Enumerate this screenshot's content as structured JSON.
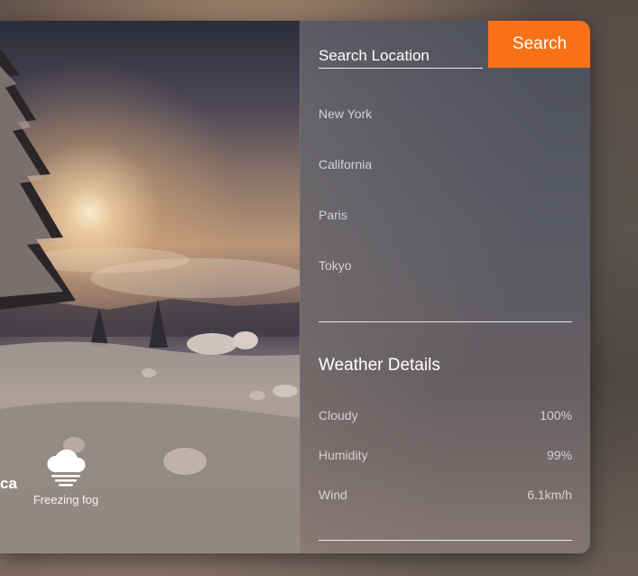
{
  "search": {
    "placeholder": "Search Location",
    "button_label": "Search"
  },
  "locations": [
    "New York",
    "California",
    "Paris",
    "Tokyo"
  ],
  "weather_details": {
    "title": "Weather Details",
    "rows": [
      {
        "label": "Cloudy",
        "value": "100%"
      },
      {
        "label": "Humidity",
        "value": "99%"
      },
      {
        "label": "Wind",
        "value": "6.1km/h"
      }
    ]
  },
  "current": {
    "city_fragment": "ca",
    "condition": "Freezing fog",
    "condition_icon": "cloud-fog-icon"
  },
  "colors": {
    "accent": "#f97218"
  }
}
